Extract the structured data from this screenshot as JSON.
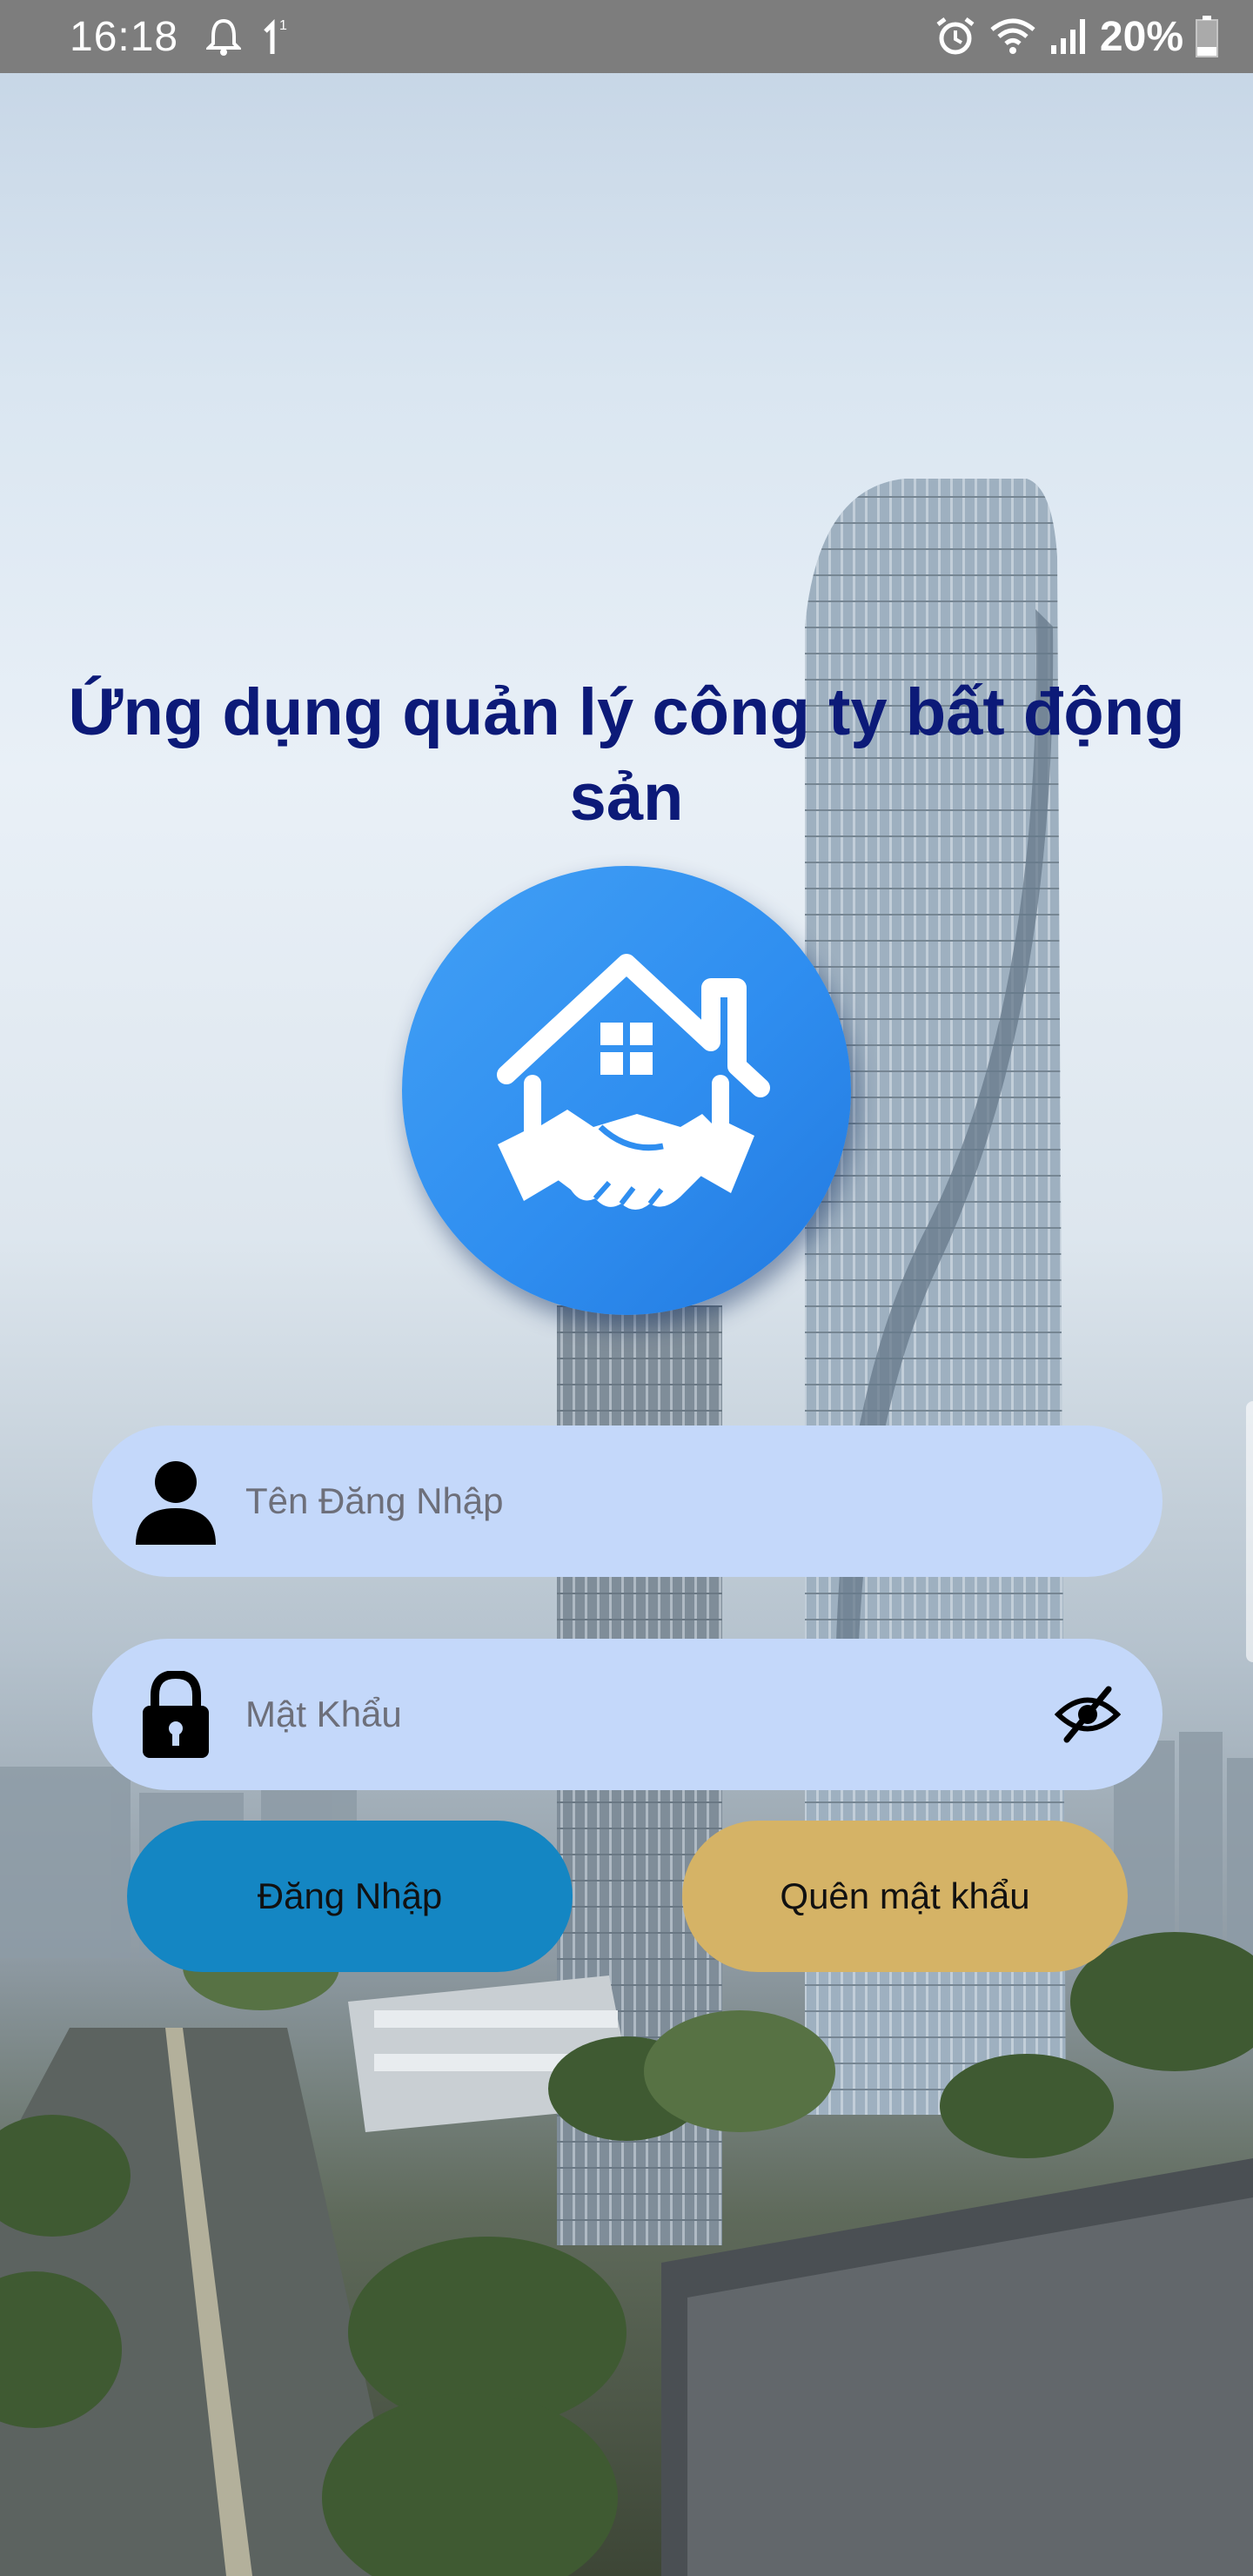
{
  "status_bar": {
    "time": "16:18",
    "notification_count": "1",
    "battery_percent": "20%"
  },
  "app": {
    "title": "Ứng dụng quản lý công ty bất động sản"
  },
  "form": {
    "username_placeholder": "Tên Đăng Nhập",
    "password_placeholder": "Mật Khẩu",
    "login_label": "Đăng Nhập",
    "forgot_label": "Quên mật khẩu"
  },
  "icons": {
    "username": "person-icon",
    "password": "lock-icon",
    "eye": "eye-off-icon",
    "logo": "house-handshake-logo"
  },
  "colors": {
    "title": "#0c1a78",
    "field_bg": "#c4d8fa",
    "login_button": "#1486c3",
    "forgot_button": "#d5b366",
    "logo_bg": "#2f8ef0",
    "status_bar": "#7d7d7d"
  }
}
